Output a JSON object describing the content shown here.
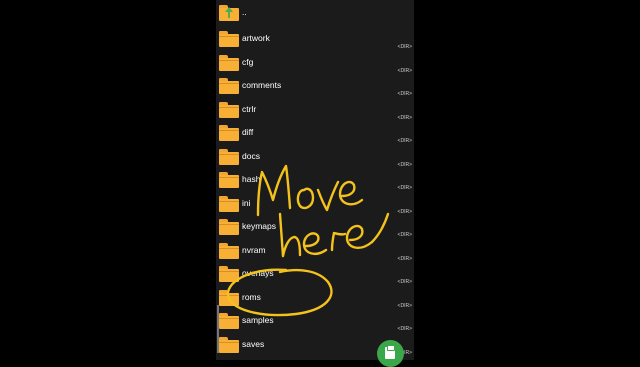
{
  "files": {
    "parent_label": "..",
    "dir_tag": "<DIR>",
    "items": [
      {
        "name": "artwork"
      },
      {
        "name": "cfg"
      },
      {
        "name": "comments"
      },
      {
        "name": "ctrlr"
      },
      {
        "name": "diff"
      },
      {
        "name": "docs"
      },
      {
        "name": "hash"
      },
      {
        "name": "ini"
      },
      {
        "name": "keymaps"
      },
      {
        "name": "nvram"
      },
      {
        "name": "overlays"
      },
      {
        "name": "roms"
      },
      {
        "name": "samples"
      },
      {
        "name": "saves"
      }
    ]
  },
  "annotation": {
    "text_line1": "Move",
    "text_line2": "here",
    "color": "#f4c21c",
    "circled_item": "roms"
  },
  "fab": {
    "icon": "clipboard-icon",
    "color": "#3aa84a"
  },
  "colors": {
    "folder": "#f7b035",
    "background": "#1b1b1b"
  }
}
